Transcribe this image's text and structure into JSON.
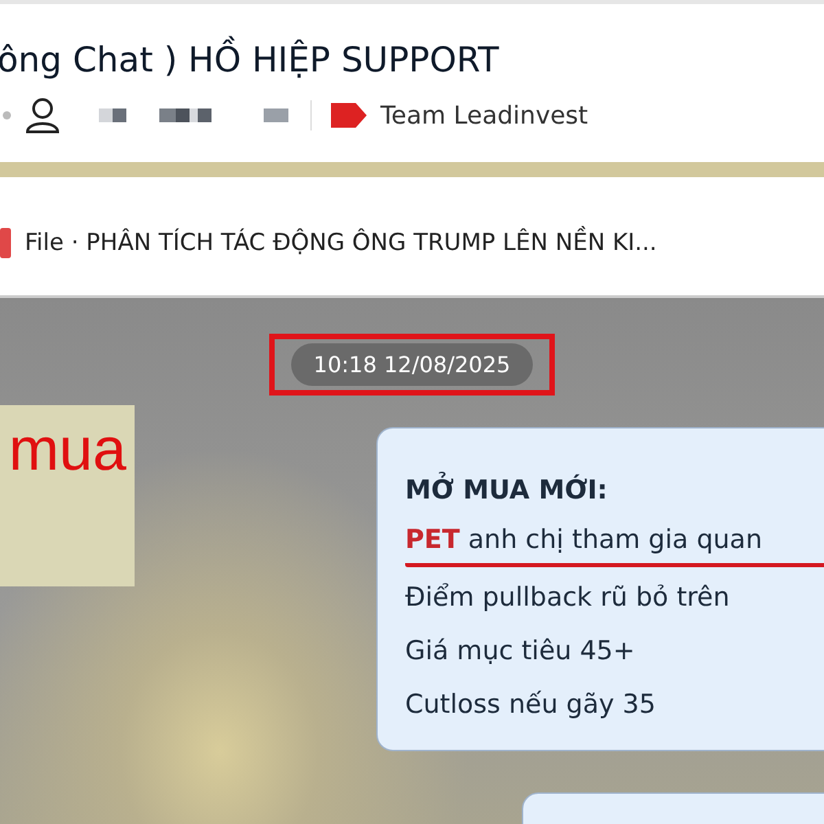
{
  "header": {
    "title": "ông Chat ) HỒ HIỆP SUPPORT",
    "tag": {
      "label": "Team Leadinvest",
      "color": "#dd2222"
    }
  },
  "pinned": {
    "label": "File",
    "separator": "·",
    "text": "PHÂN TÍCH TÁC ĐỘNG ÔNG TRUMP LÊN NỀN KI..."
  },
  "chat": {
    "timestamp": "10:18 12/08/2025",
    "timestamp_highlighted": true,
    "side_card": {
      "text": "mua"
    },
    "message": {
      "lines": [
        {
          "kind": "heading",
          "text": "MỞ MUA MỚI:"
        },
        {
          "kind": "highlight",
          "ticker": "PET",
          "text": "anh chị tham gia quan",
          "underlined": true
        },
        {
          "kind": "plain",
          "text": "Điểm pullback rũ bỏ trên"
        },
        {
          "kind": "plain",
          "text": "Giá mục tiêu 45+"
        },
        {
          "kind": "plain",
          "text": "Cutloss nếu gãy 35"
        }
      ]
    }
  }
}
